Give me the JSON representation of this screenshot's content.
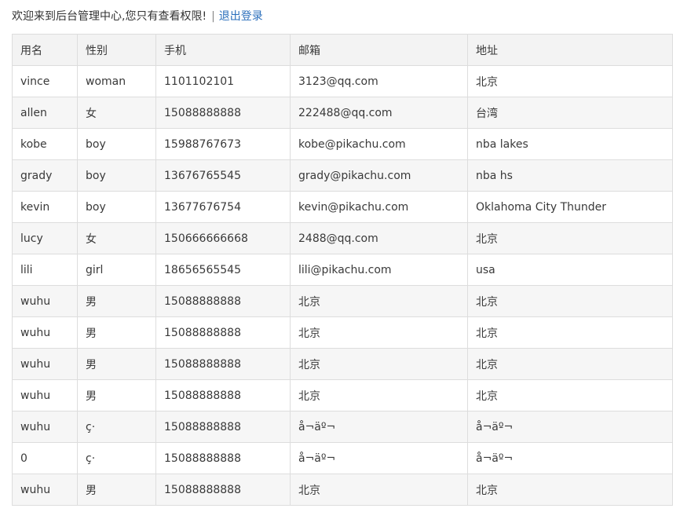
{
  "header": {
    "welcome_text": "欢迎来到后台管理中心,您只有查看权限!",
    "separator": "|",
    "logout_label": "退出登录"
  },
  "table": {
    "columns": [
      "用名",
      "性别",
      "手机",
      "邮箱",
      "地址"
    ],
    "rows": [
      [
        "vince",
        "woman",
        "1101102101",
        "3123@qq.com",
        "北京"
      ],
      [
        "allen",
        "女",
        "15088888888",
        "222488@qq.com",
        "台湾"
      ],
      [
        "kobe",
        "boy",
        "15988767673",
        "kobe@pikachu.com",
        "nba lakes"
      ],
      [
        "grady",
        "boy",
        "13676765545",
        "grady@pikachu.com",
        "nba hs"
      ],
      [
        "kevin",
        "boy",
        "13677676754",
        "kevin@pikachu.com",
        "Oklahoma City Thunder"
      ],
      [
        "lucy",
        "女",
        "150666666668",
        "2488@qq.com",
        "北京"
      ],
      [
        "lili",
        "girl",
        "18656565545",
        "lili@pikachu.com",
        "usa"
      ],
      [
        "wuhu",
        "男",
        "15088888888",
        "北京",
        "北京"
      ],
      [
        "wuhu",
        "男",
        "15088888888",
        "北京",
        "北京"
      ],
      [
        "wuhu",
        "男",
        "15088888888",
        "北京",
        "北京"
      ],
      [
        "wuhu",
        "男",
        "15088888888",
        "北京",
        "北京"
      ],
      [
        "wuhu",
        "ç·",
        "15088888888",
        "å¬äº¬",
        "å¬äº¬"
      ],
      [
        "0",
        "ç·",
        "15088888888",
        "å¬äº¬",
        "å¬äº¬"
      ],
      [
        "wuhu",
        "男",
        "15088888888",
        "北京",
        "北京"
      ]
    ]
  }
}
